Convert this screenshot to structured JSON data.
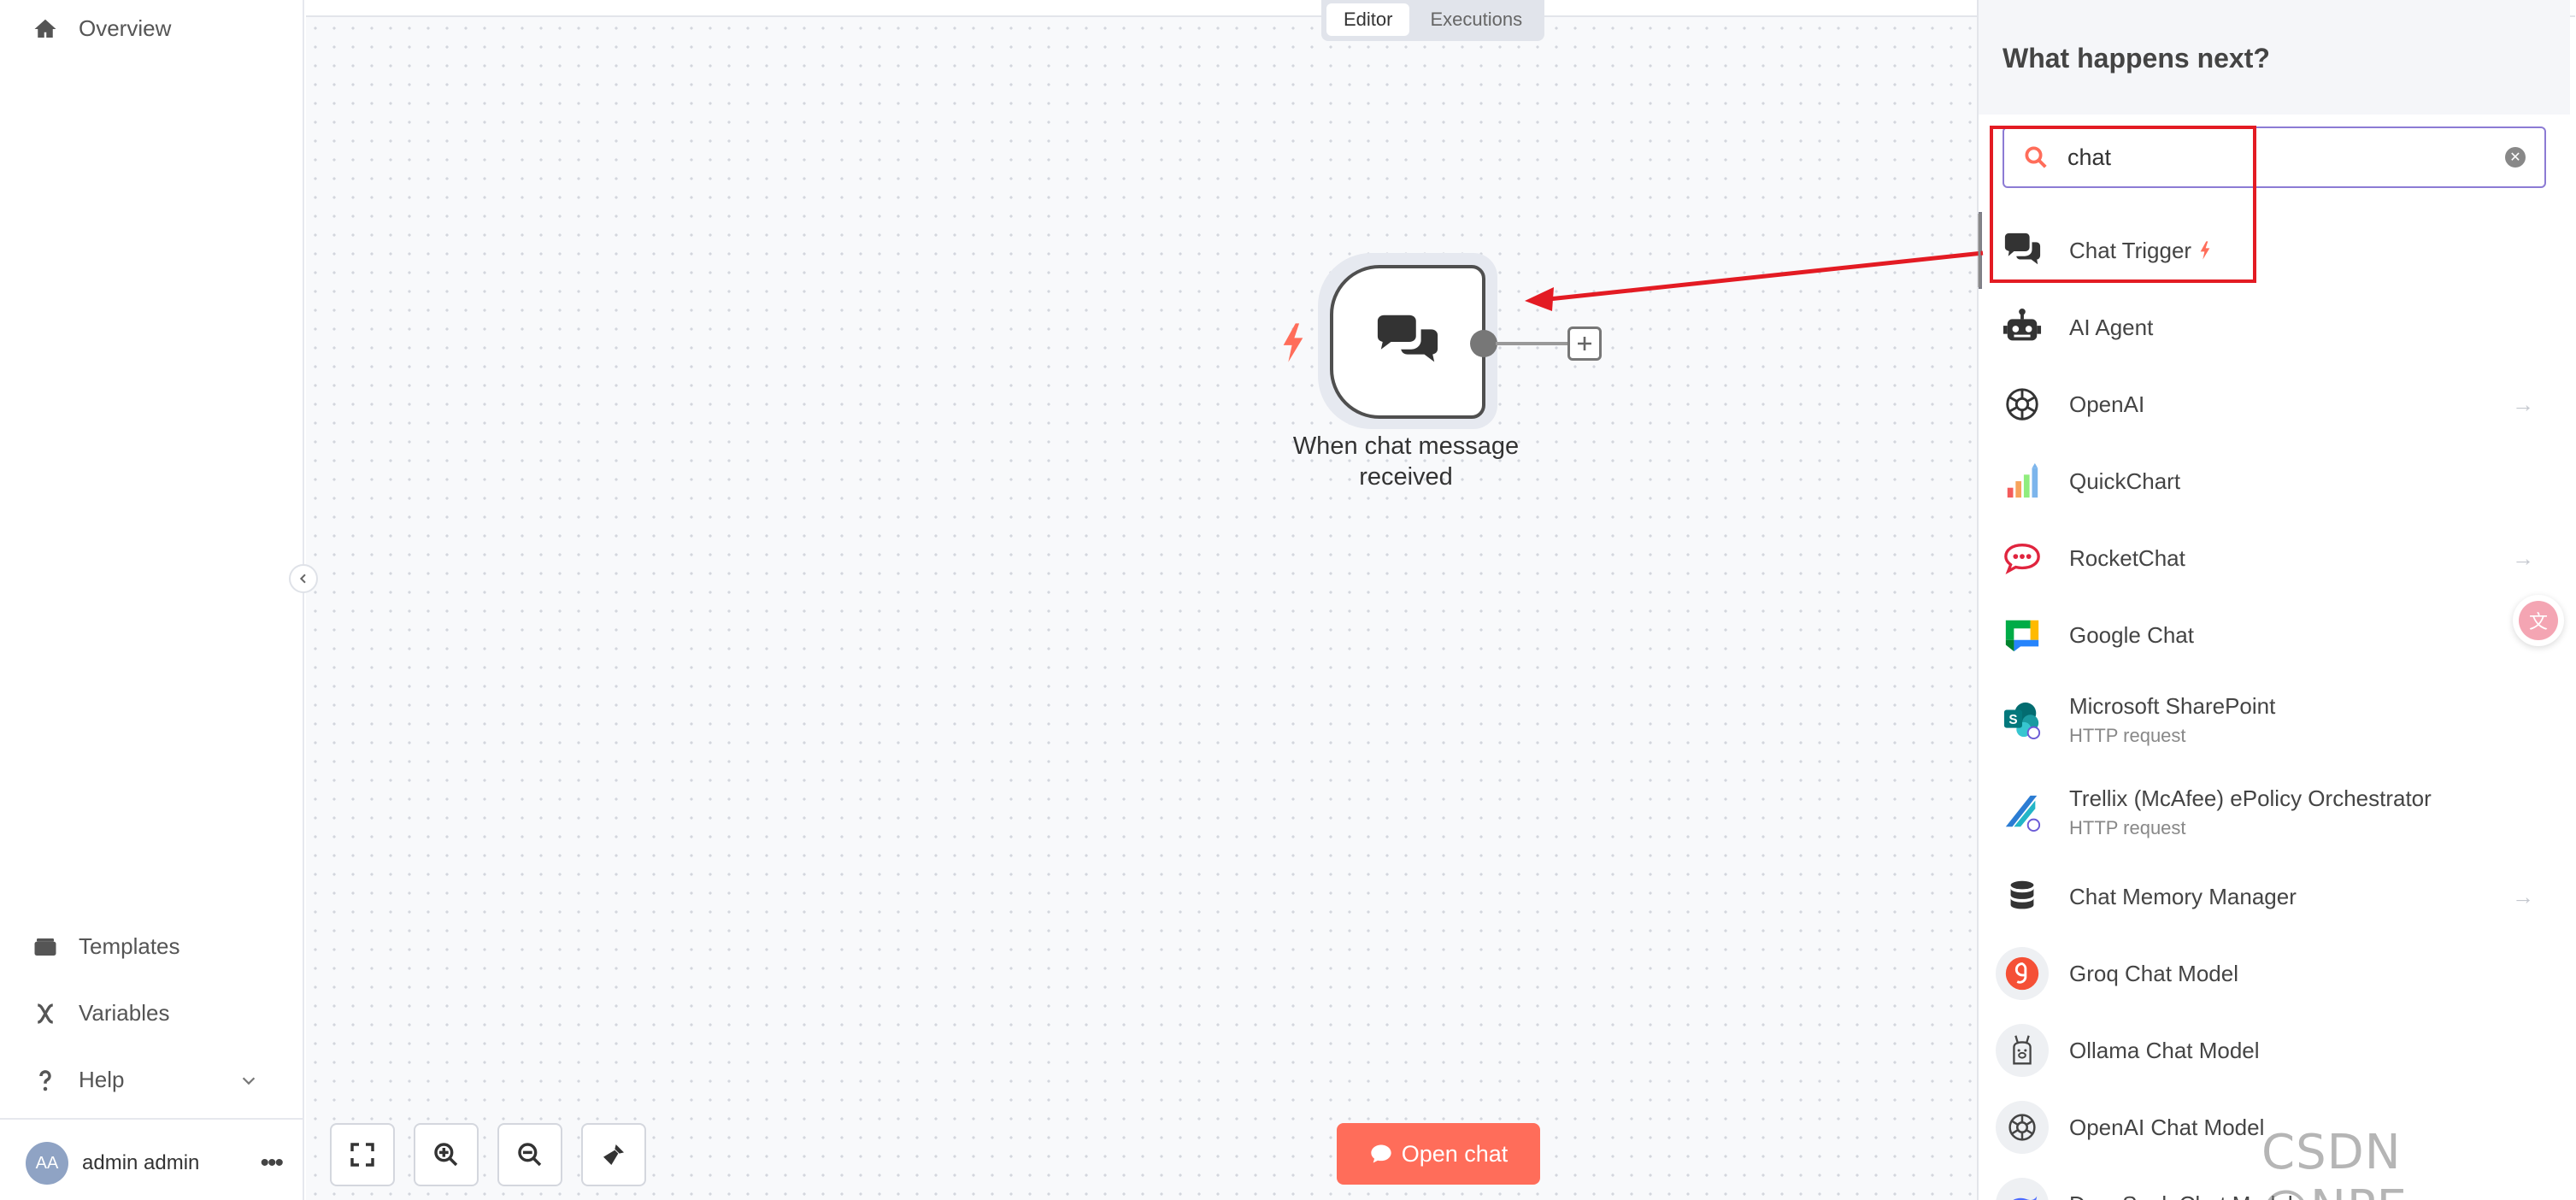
{
  "sidebar": {
    "overview": "Overview",
    "templates": "Templates",
    "variables": "Variables",
    "help": "Help",
    "user": {
      "initials": "AA",
      "name": "admin admin",
      "more": "•••"
    }
  },
  "tabs": {
    "editor": "Editor",
    "executions": "Executions"
  },
  "node": {
    "label_line1": "When chat message",
    "label_line2": "received"
  },
  "open_chat_label": "Open chat",
  "panel": {
    "title": "What happens next?",
    "search_value": "chat",
    "results": [
      {
        "name": "Chat Trigger",
        "icon": "chat-bubbles-icon",
        "trigger": true
      },
      {
        "name": "AI Agent",
        "icon": "robot-icon"
      },
      {
        "name": "OpenAI",
        "icon": "openai-icon",
        "arrow": true
      },
      {
        "name": "QuickChart",
        "icon": "quickchart-icon"
      },
      {
        "name": "RocketChat",
        "icon": "rocketchat-icon",
        "arrow": true
      },
      {
        "name": "Google Chat",
        "icon": "google-chat-icon"
      },
      {
        "name": "Microsoft SharePoint",
        "sub": "HTTP request",
        "icon": "sharepoint-icon"
      },
      {
        "name": "Trellix (McAfee) ePolicy Orchestrator",
        "sub": "HTTP request",
        "icon": "trellix-icon"
      },
      {
        "name": "Chat Memory Manager",
        "icon": "database-icon",
        "arrow": true
      },
      {
        "name": "Groq Chat Model",
        "icon": "groq-icon"
      },
      {
        "name": "Ollama Chat Model",
        "icon": "ollama-icon"
      },
      {
        "name": "OpenAI Chat Model",
        "icon": "openai-icon"
      },
      {
        "name": "DeepSeek Chat Model",
        "icon": "deepseek-icon"
      }
    ]
  },
  "watermark": "CSDN @NPE~",
  "colors": {
    "accent": "#ff6d5a",
    "highlight": "#e31b23",
    "search_border": "#8c7bd4"
  }
}
